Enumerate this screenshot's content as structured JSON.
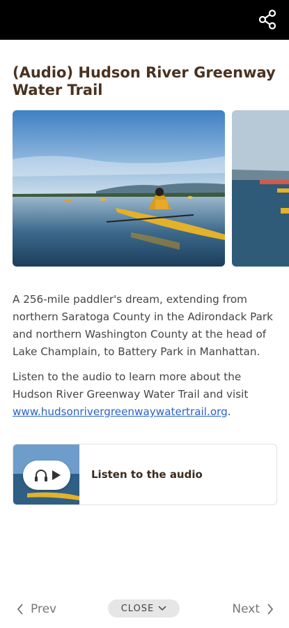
{
  "header": {
    "share_icon": "share-icon"
  },
  "article": {
    "title": "(Audio) Hudson River Greenway Water Trail",
    "paragraph1": "A 256-mile paddler's dream, extending from northern Saratoga County in the Adirondack Park and northern Washington County at the head of Lake Champlain, to Battery Park in Manhattan.",
    "paragraph2_text": "Listen to the audio to learn more about the Hudson River Greenway Water Trail and visit ",
    "paragraph2_link": "www.hudsonrivergreenwaywatertrail.org",
    "paragraph2_end": "."
  },
  "audio": {
    "label": "Listen to the audio",
    "icons": [
      "headphones-icon",
      "play-icon"
    ]
  },
  "footer": {
    "prev_label": "Prev",
    "close_label": "CLOSE",
    "next_label": "Next"
  },
  "colors": {
    "title": "#4a3220",
    "link": "#2a63c6",
    "topbar": "#000000"
  }
}
